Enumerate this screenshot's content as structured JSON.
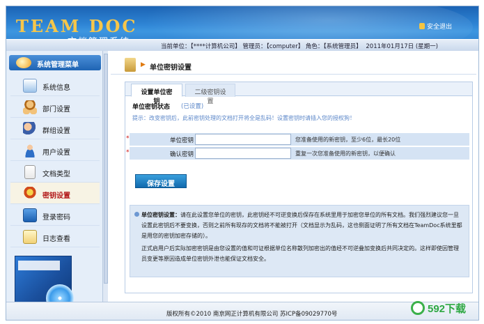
{
  "header": {
    "logo_text": "TEAM DOC",
    "subtitle": "文档管理系统",
    "logout_label": "安全退出",
    "info_text": "当前单位：【****计算机公司】 管理员：【computer】 角色：【系统管理员】",
    "date_text": "2011年01月17日 (星期一)"
  },
  "sidebar": {
    "menu_title": "系统管理菜单",
    "items": [
      {
        "label": "系统信息",
        "icon": "system-info-icon"
      },
      {
        "label": "部门设置",
        "icon": "department-icon"
      },
      {
        "label": "群组设置",
        "icon": "group-icon"
      },
      {
        "label": "用户设置",
        "icon": "user-icon"
      },
      {
        "label": "文档类型",
        "icon": "document-type-icon"
      },
      {
        "label": "密钥设置",
        "icon": "key-icon"
      },
      {
        "label": "登录密码",
        "icon": "login-password-icon"
      },
      {
        "label": "日志查看",
        "icon": "log-icon"
      }
    ],
    "active_item": "密钥设置",
    "active_color": "#b21818"
  },
  "main": {
    "page_title": "单位密钥设置",
    "tabs": [
      {
        "label": "设置单位密钥"
      },
      {
        "label": "二级密钥设置"
      }
    ],
    "status_label": "单位密钥状态",
    "status_value": "(已设置)",
    "hint": "提示：改变密钥后，此前密钥处理的文档打开将全是乱码！设置密钥时请插入您的授权狗！",
    "fields": [
      {
        "label": "单位密钥",
        "value": "",
        "note": "您准备使用的新密钥，至少6位，最长20位"
      },
      {
        "label": "确认密钥",
        "value": "",
        "note": "重复一次您准备使用的新密钥，以便确认"
      }
    ],
    "save_button": "保存设置",
    "note_title": "单位密钥设置：",
    "note_para1": "请在此设置您单位的密钥，此密钥经不可逆变换后保存在系统里用于加密您单位的所有文档。我们强烈建议您一旦设置此密钥后不要变换，否则之前所有现存的文档将不能被打开（文档显示为乱码，这也侧面证明了所有文档在TeamDoc系统里都是用您的密钥加密存储的）。",
    "note_para2": "正式启用户后实际加密密钥是由您设置的值和可证根据单位名称散列加密出的值经不可逆叠加变换后共同决定的。这样即使因管理员变更等原因造成单位密钥外泄也能保证文档安全。"
  },
  "footer": {
    "copyright": "版权所有©2010 南京网正计算机有限公司 苏ICP备09029770号"
  },
  "watermark": {
    "text": "592下载"
  }
}
